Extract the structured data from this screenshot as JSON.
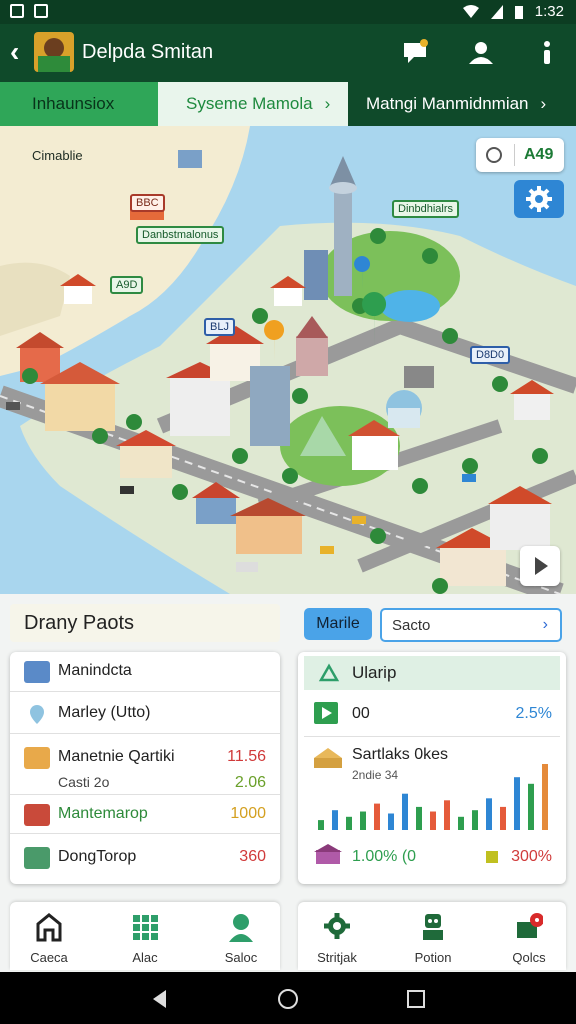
{
  "status_bar": {
    "time": "1:32"
  },
  "app_bar": {
    "title": "Delpda Smitan"
  },
  "tabs": [
    {
      "label": "Inhaunsiox"
    },
    {
      "label": "Syseme Mamola"
    },
    {
      "label": "Matngi Manmidnmian"
    }
  ],
  "map": {
    "search_value": "A49",
    "labels": [
      "Cimablie",
      "Danbstmalonus",
      "Dinbdhialrs",
      "A9D",
      "BLJ",
      "D8D0",
      "BBC"
    ]
  },
  "panel": {
    "title": "Drany Paots",
    "toggle_label": "Marile",
    "select_value": "Sacto"
  },
  "list": [
    {
      "label": "Manindcta",
      "value": ""
    },
    {
      "label": "Marley (Utto)",
      "value": ""
    },
    {
      "label": "Manetnie Qartiki",
      "sub": "Casti 2o",
      "value": "11.56",
      "value2": "2.06"
    },
    {
      "label": "Mantemarop",
      "value": "1000"
    },
    {
      "label": "DongTorop",
      "value": "360"
    }
  ],
  "stats": {
    "header": "Ularip",
    "metric_label": "00",
    "metric_value": "2.5%",
    "chart_title": "Sartlaks 0kes",
    "chart_subtitle": "2ndie 34",
    "footer_left": "1.00% (0",
    "footer_right": "300%",
    "bars": [
      {
        "value": 15,
        "color": "#2e9e4f"
      },
      {
        "value": 30,
        "color": "#2e86d4"
      },
      {
        "value": 20,
        "color": "#2e9e4f"
      },
      {
        "value": 28,
        "color": "#2e9e4f"
      },
      {
        "value": 40,
        "color": "#e55a3a"
      },
      {
        "value": 25,
        "color": "#2e86d4"
      },
      {
        "value": 55,
        "color": "#2e86d4"
      },
      {
        "value": 35,
        "color": "#2e9e4f"
      },
      {
        "value": 28,
        "color": "#e55a3a"
      },
      {
        "value": 45,
        "color": "#e55a3a"
      },
      {
        "value": 20,
        "color": "#2e9e4f"
      },
      {
        "value": 30,
        "color": "#2e9e4f"
      },
      {
        "value": 48,
        "color": "#2e86d4"
      },
      {
        "value": 35,
        "color": "#e55a3a"
      },
      {
        "value": 80,
        "color": "#2e86d4"
      },
      {
        "value": 70,
        "color": "#2e9e4f"
      },
      {
        "value": 100,
        "color": "#e58a3a"
      }
    ]
  },
  "bottom_nav_left": [
    {
      "label": "Caeca",
      "icon": "home-icon"
    },
    {
      "label": "Alac",
      "icon": "grid-icon"
    },
    {
      "label": "Saloc",
      "icon": "person-icon"
    }
  ],
  "bottom_nav_right": [
    {
      "label": "Stritjak",
      "icon": "gear-icon"
    },
    {
      "label": "Potion",
      "icon": "robot-icon"
    },
    {
      "label": "Qolcs",
      "icon": "chat-icon"
    }
  ],
  "colors": {
    "primary": "#0f4a2a",
    "accent": "#2fa658",
    "blue": "#2e86d4",
    "red": "#e55a3a"
  }
}
